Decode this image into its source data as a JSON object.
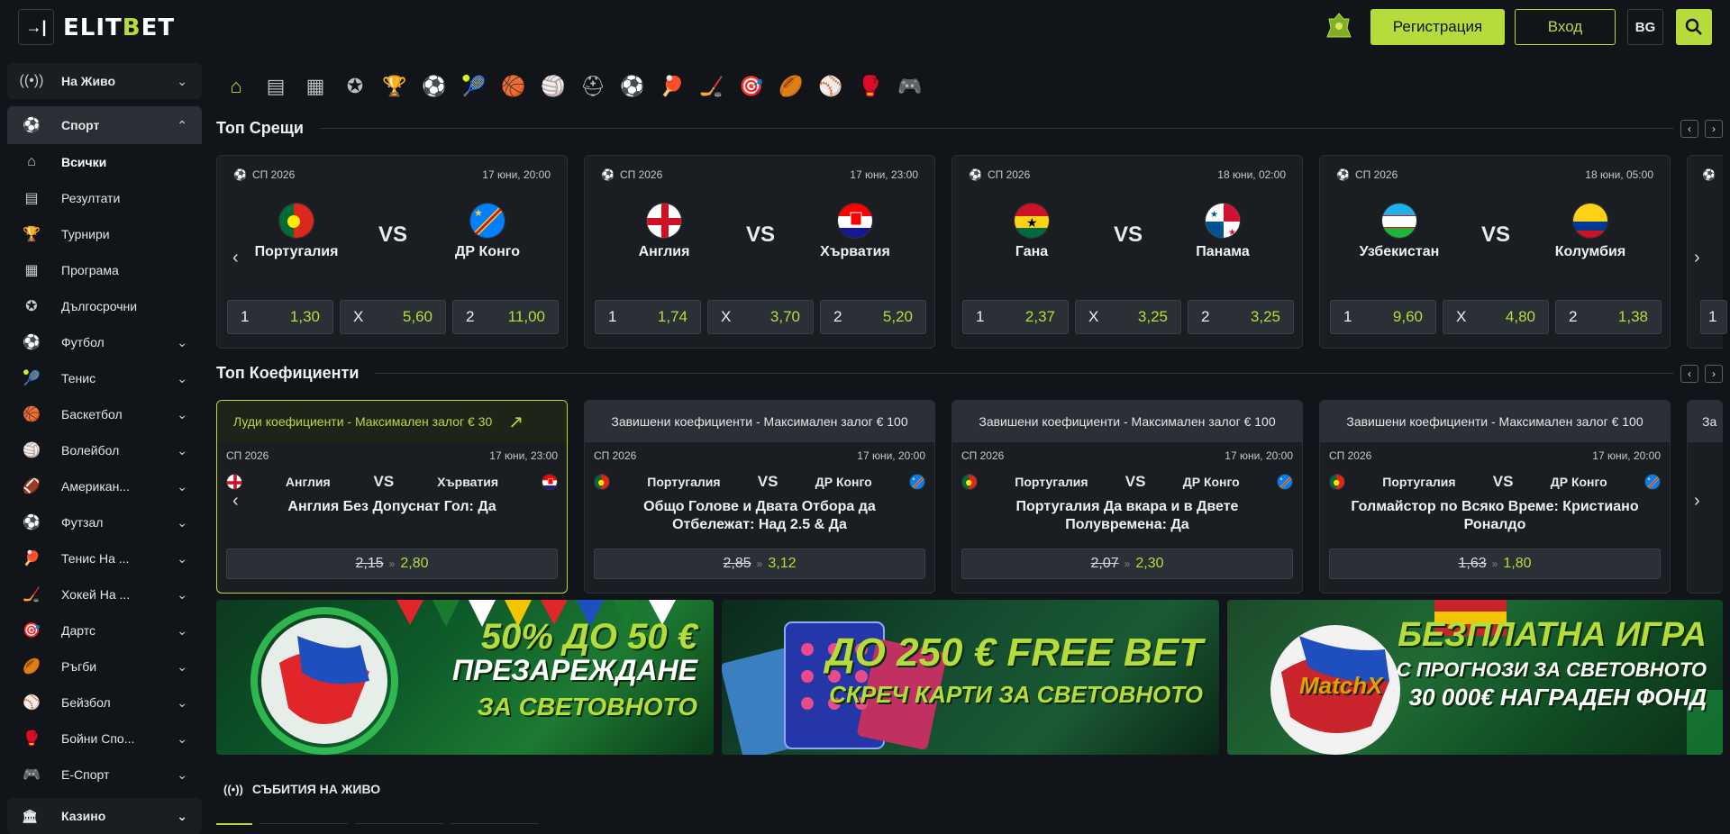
{
  "header": {
    "logo_icon": "→|",
    "logo_text_a": "ELIT",
    "logo_text_b": "B",
    "logo_text_c": "ET",
    "register": "Регистрация",
    "login": "Вход",
    "lang": "BG"
  },
  "sidebar": {
    "live": "На Живо",
    "sport": "Спорт",
    "sub_items": [
      {
        "label": "Всички",
        "icon": "home-icon"
      },
      {
        "label": "Резултати",
        "icon": "results-icon"
      },
      {
        "label": "Турнири",
        "icon": "trophy-icon"
      },
      {
        "label": "Програма",
        "icon": "calendar-icon"
      },
      {
        "label": "Дългосрочни",
        "icon": "award-icon"
      }
    ],
    "sports": [
      {
        "label": "Футбол",
        "icon": "⚽"
      },
      {
        "label": "Тенис",
        "icon": "🎾"
      },
      {
        "label": "Баскетбол",
        "icon": "🏀"
      },
      {
        "label": "Волейбол",
        "icon": "🏐"
      },
      {
        "label": "Американ...",
        "icon": "🏈"
      },
      {
        "label": "Футзал",
        "icon": "⚽"
      },
      {
        "label": "Тенис На ...",
        "icon": "🏓"
      },
      {
        "label": "Хокей На ...",
        "icon": "🏒"
      },
      {
        "label": "Дартс",
        "icon": "🎯"
      },
      {
        "label": "Ръгби",
        "icon": "🏉"
      },
      {
        "label": "Бейзбол",
        "icon": "⚾"
      },
      {
        "label": "Бойни Спо...",
        "icon": "🥊"
      },
      {
        "label": "Е-Спорт",
        "icon": "🎮"
      }
    ],
    "casino": "Казино"
  },
  "sections": {
    "top_matches": "Топ Срещи",
    "top_odds": "Топ Коефициенти",
    "live_events": "СЪБИТИЯ НА ЖИВО"
  },
  "matches": [
    {
      "comp": "СП 2026",
      "date": "17 юни, 20:00",
      "home": "Португалия",
      "away": "ДР Конго",
      "vs": "VS",
      "o1": "1,30",
      "ox": "5,60",
      "o2": "11,00"
    },
    {
      "comp": "СП 2026",
      "date": "17 юни, 23:00",
      "home": "Англия",
      "away": "Хърватия",
      "vs": "VS",
      "o1": "1,74",
      "ox": "3,70",
      "o2": "5,20"
    },
    {
      "comp": "СП 2026",
      "date": "18 юни, 02:00",
      "home": "Гана",
      "away": "Панама",
      "vs": "VS",
      "o1": "2,37",
      "ox": "3,25",
      "o2": "3,25"
    },
    {
      "comp": "СП 2026",
      "date": "18 юни, 05:00",
      "home": "Узбекистан",
      "away": "Колумбия",
      "vs": "VS",
      "o1": "9,60",
      "ox": "4,80",
      "o2": "1,38"
    }
  ],
  "odds_labels": {
    "one": "1",
    "x": "X",
    "two": "2"
  },
  "offers": [
    {
      "head": "Луди коефициенти - Максимален залог € 30",
      "comp": "СП 2026",
      "date": "17 юни, 23:00",
      "home": "Англия",
      "away": "Хърватия",
      "market": "Англия Без Допуснат Гол: Да",
      "old": "2,15",
      "new": "2,80"
    },
    {
      "head": "Завишени коефициенти - Максимален залог € 100",
      "comp": "СП 2026",
      "date": "17 юни, 20:00",
      "home": "Португалия",
      "away": "ДР Конго",
      "market": "Общо Голове и Двата Отбора да Отбележат: Над 2.5 & Да",
      "old": "2,85",
      "new": "3,12"
    },
    {
      "head": "Завишени коефициенти - Максимален залог € 100",
      "comp": "СП 2026",
      "date": "17 юни, 20:00",
      "home": "Португалия",
      "away": "ДР Конго",
      "market": "Португалия Да вкара и в Двете Полувремена: Да",
      "old": "2,07",
      "new": "2,30"
    },
    {
      "head": "Завишени коефициенти - Максимален залог € 100",
      "comp": "СП 2026",
      "date": "17 юни, 20:00",
      "home": "Португалия",
      "away": "ДР Конго",
      "market": "Голмайстор по Всяко Време: Кристиано Роналдо",
      "old": "1,63",
      "new": "1,80"
    }
  ],
  "banners": [
    {
      "l1": "50% ДО 50 €",
      "l2": "ПРЕЗАРЕЖДАНЕ",
      "l3": "ЗА СВЕТОВНОТО"
    },
    {
      "l1": "ДО 250 € FREE BET",
      "l2": "СКРЕЧ КАРТИ ЗА СВЕТОВНОТО"
    },
    {
      "l1": "БЕЗПЛАТНА ИГРА",
      "l2": "С ПРОГНОЗИ ЗА СВЕТОВНОТО",
      "l3": "30 000€ НАГРАДЕН ФОНД",
      "logo": "MatchX"
    }
  ],
  "colors": {
    "accent": "#b6dc3c",
    "bg": "#111418",
    "card": "#1a1e23"
  }
}
